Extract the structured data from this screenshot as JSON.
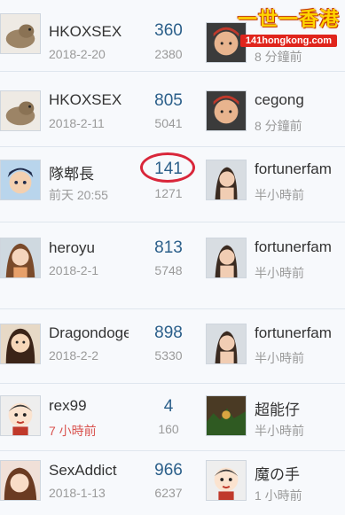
{
  "watermark": {
    "title": "一世一香港",
    "url": "141hongkong.com"
  },
  "rows": [
    {
      "author": "HKOXSEX",
      "date": "2018-2-20",
      "replies": "360",
      "views": "2380",
      "last_user": "",
      "last_time": "8 分鐘前"
    },
    {
      "author": "HKOXSEX",
      "date": "2018-2-11",
      "replies": "805",
      "views": "5041",
      "last_user": "cegong",
      "last_time": "8 分鐘前"
    },
    {
      "author": "隊郫長",
      "date": "前天 20:55",
      "replies": "141",
      "views": "1271",
      "last_user": "fortunerfam",
      "last_time": "半小時前"
    },
    {
      "author": "heroyu",
      "date": "2018-2-1",
      "replies": "813",
      "views": "5748",
      "last_user": "fortunerfam",
      "last_time": "半小時前"
    },
    {
      "author": "Dragondoge",
      "date": "2018-2-2",
      "replies": "898",
      "views": "5330",
      "last_user": "fortunerfam",
      "last_time": "半小時前"
    },
    {
      "author": "rex99",
      "date": "7 小時前",
      "replies": "4",
      "views": "160",
      "last_user": "超能仔",
      "last_time": "半小時前"
    },
    {
      "author": "SexAddict",
      "date": "2018-1-13",
      "replies": "966",
      "views": "6237",
      "last_user": "魔の手",
      "last_time": "1 小時前"
    }
  ]
}
